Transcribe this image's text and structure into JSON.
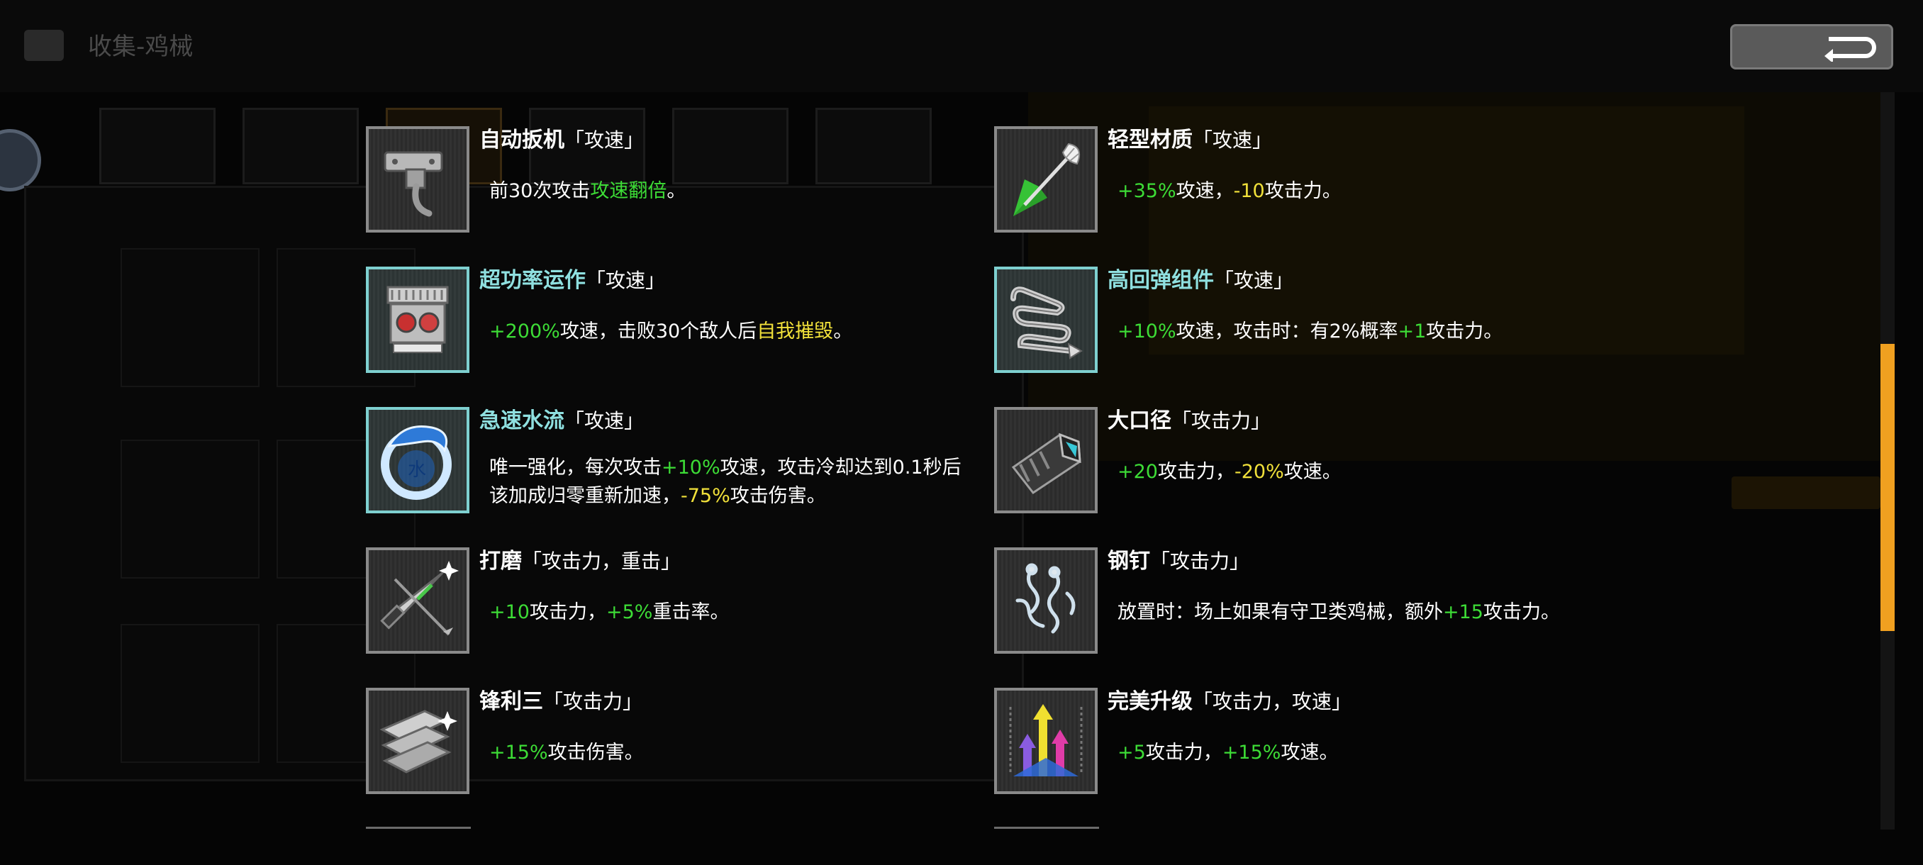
{
  "header": {
    "title": "收集-鸡械"
  },
  "colors": {
    "green": "#3ddc36",
    "yellow": "#f0e03a",
    "rare_border": "#7ed0d0",
    "scroll_accent": "#f0a020"
  },
  "items": [
    {
      "name": "自动扳机",
      "tag": "「攻速」",
      "icon": "trigger-icon",
      "rare": false,
      "desc": [
        {
          "t": "前30次攻击"
        },
        {
          "t": "攻速翻倍",
          "c": "g"
        },
        {
          "t": "。"
        }
      ]
    },
    {
      "name": "轻型材质",
      "tag": "「攻速」",
      "icon": "feather-arrow-icon",
      "rare": false,
      "desc": [
        {
          "t": "+35%",
          "c": "g"
        },
        {
          "t": "攻速，"
        },
        {
          "t": "-10",
          "c": "y"
        },
        {
          "t": "攻击力。"
        }
      ]
    },
    {
      "name": "超功率运作",
      "tag": "「攻速」",
      "icon": "engine-icon",
      "rare": true,
      "desc": [
        {
          "t": "+200%",
          "c": "g"
        },
        {
          "t": "攻速，击败30个敌人后"
        },
        {
          "t": "自我摧毁",
          "c": "y"
        },
        {
          "t": "。"
        }
      ]
    },
    {
      "name": "高回弹组件",
      "tag": "「攻速」",
      "icon": "spring-icon",
      "rare": true,
      "desc": [
        {
          "t": "+10%",
          "c": "g"
        },
        {
          "t": "攻速，攻击时：有2%概率"
        },
        {
          "t": "+1",
          "c": "g"
        },
        {
          "t": "攻击力。"
        }
      ]
    },
    {
      "name": "急速水流",
      "tag": "「攻速」",
      "icon": "water-wave-icon",
      "rare": true,
      "desc": [
        {
          "t": "唯一强化，每次攻击"
        },
        {
          "t": "+10%",
          "c": "g"
        },
        {
          "t": "攻速，攻击冷却达到0.1秒后该加成归零重新加速，"
        },
        {
          "t": "-75%",
          "c": "y"
        },
        {
          "t": "攻击伤害。"
        }
      ]
    },
    {
      "name": "大口径",
      "tag": "「攻击力」",
      "icon": "cannon-barrel-icon",
      "rare": false,
      "desc": [
        {
          "t": "+20",
          "c": "g"
        },
        {
          "t": "攻击力，"
        },
        {
          "t": "-20%",
          "c": "y"
        },
        {
          "t": "攻速。"
        }
      ]
    },
    {
      "name": "打磨",
      "tag": "「攻击力，重击」",
      "icon": "knife-icon",
      "rare": false,
      "desc": [
        {
          "t": "+10",
          "c": "g"
        },
        {
          "t": "攻击力，"
        },
        {
          "t": "+5%",
          "c": "g"
        },
        {
          "t": "重击率。"
        }
      ]
    },
    {
      "name": "钢钉",
      "tag": "「攻击力」",
      "icon": "nails-icon",
      "rare": false,
      "desc": [
        {
          "t": "放置时：场上如果有守卫类鸡械，额外"
        },
        {
          "t": "+15",
          "c": "g"
        },
        {
          "t": "攻击力。"
        }
      ]
    },
    {
      "name": "锋利三",
      "tag": "「攻击力」",
      "icon": "blades-icon",
      "rare": false,
      "desc": [
        {
          "t": "+15%",
          "c": "g"
        },
        {
          "t": "攻击伤害。"
        }
      ]
    },
    {
      "name": "完美升级",
      "tag": "「攻击力，攻速」",
      "icon": "upgrade-arrows-icon",
      "rare": false,
      "desc": [
        {
          "t": "+5",
          "c": "g"
        },
        {
          "t": "攻击力，"
        },
        {
          "t": "+15%",
          "c": "g"
        },
        {
          "t": "攻速。"
        }
      ]
    }
  ]
}
